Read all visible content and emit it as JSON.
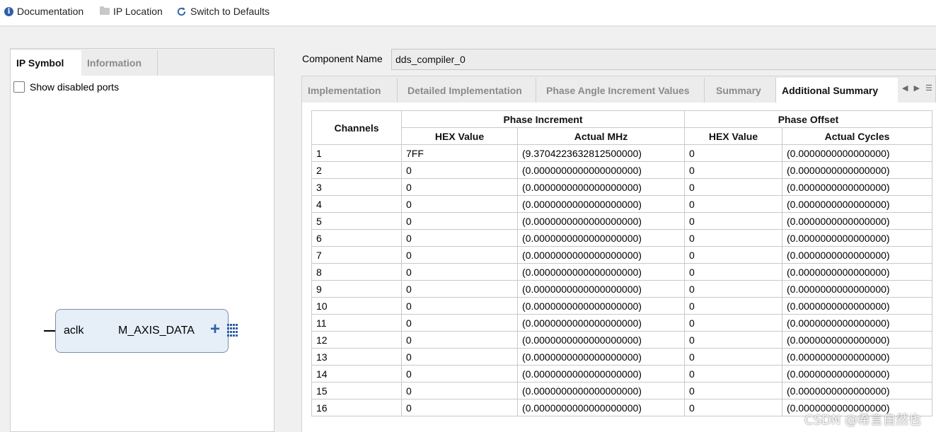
{
  "toolbar": {
    "documentation": "Documentation",
    "ip_location": "IP Location",
    "switch_defaults": "Switch to Defaults"
  },
  "left_panel": {
    "tabs": [
      "IP Symbol",
      "Information"
    ],
    "show_disabled_ports": "Show disabled ports",
    "symbol": {
      "input_port": "aclk",
      "output_port": "M_AXIS_DATA"
    }
  },
  "component": {
    "label": "Component Name",
    "value": "dds_compiler_0"
  },
  "tabs": [
    "Implementation",
    "Detailed Implementation",
    "Phase Angle Increment Values",
    "Summary",
    "Additional Summary"
  ],
  "active_tab": "Additional Summary",
  "table": {
    "group_headers": {
      "channels": "Channels",
      "phase_increment": "Phase Increment",
      "phase_offset": "Phase Offset"
    },
    "sub_headers": [
      "HEX Value",
      "Actual MHz",
      "HEX Value",
      "Actual Cycles"
    ],
    "rows": [
      [
        "1",
        "7FF",
        "(9.3704223632812500000)",
        "0",
        "(0.0000000000000000)"
      ],
      [
        "2",
        "0",
        "(0.0000000000000000000)",
        "0",
        "(0.0000000000000000)"
      ],
      [
        "3",
        "0",
        "(0.0000000000000000000)",
        "0",
        "(0.0000000000000000)"
      ],
      [
        "4",
        "0",
        "(0.0000000000000000000)",
        "0",
        "(0.0000000000000000)"
      ],
      [
        "5",
        "0",
        "(0.0000000000000000000)",
        "0",
        "(0.0000000000000000)"
      ],
      [
        "6",
        "0",
        "(0.0000000000000000000)",
        "0",
        "(0.0000000000000000)"
      ],
      [
        "7",
        "0",
        "(0.0000000000000000000)",
        "0",
        "(0.0000000000000000)"
      ],
      [
        "8",
        "0",
        "(0.0000000000000000000)",
        "0",
        "(0.0000000000000000)"
      ],
      [
        "9",
        "0",
        "(0.0000000000000000000)",
        "0",
        "(0.0000000000000000)"
      ],
      [
        "10",
        "0",
        "(0.0000000000000000000)",
        "0",
        "(0.0000000000000000)"
      ],
      [
        "11",
        "0",
        "(0.0000000000000000000)",
        "0",
        "(0.0000000000000000)"
      ],
      [
        "12",
        "0",
        "(0.0000000000000000000)",
        "0",
        "(0.0000000000000000)"
      ],
      [
        "13",
        "0",
        "(0.0000000000000000000)",
        "0",
        "(0.0000000000000000)"
      ],
      [
        "14",
        "0",
        "(0.0000000000000000000)",
        "0",
        "(0.0000000000000000)"
      ],
      [
        "15",
        "0",
        "(0.0000000000000000000)",
        "0",
        "(0.0000000000000000)"
      ],
      [
        "16",
        "0",
        "(0.0000000000000000000)",
        "0",
        "(0.0000000000000000)"
      ]
    ]
  },
  "watermark": "CSDN @希言自然也",
  "colors": {
    "accent": "#2e5fa8",
    "symbol_fill": "#e6eff8",
    "grid_line": "#c9c9c9"
  }
}
